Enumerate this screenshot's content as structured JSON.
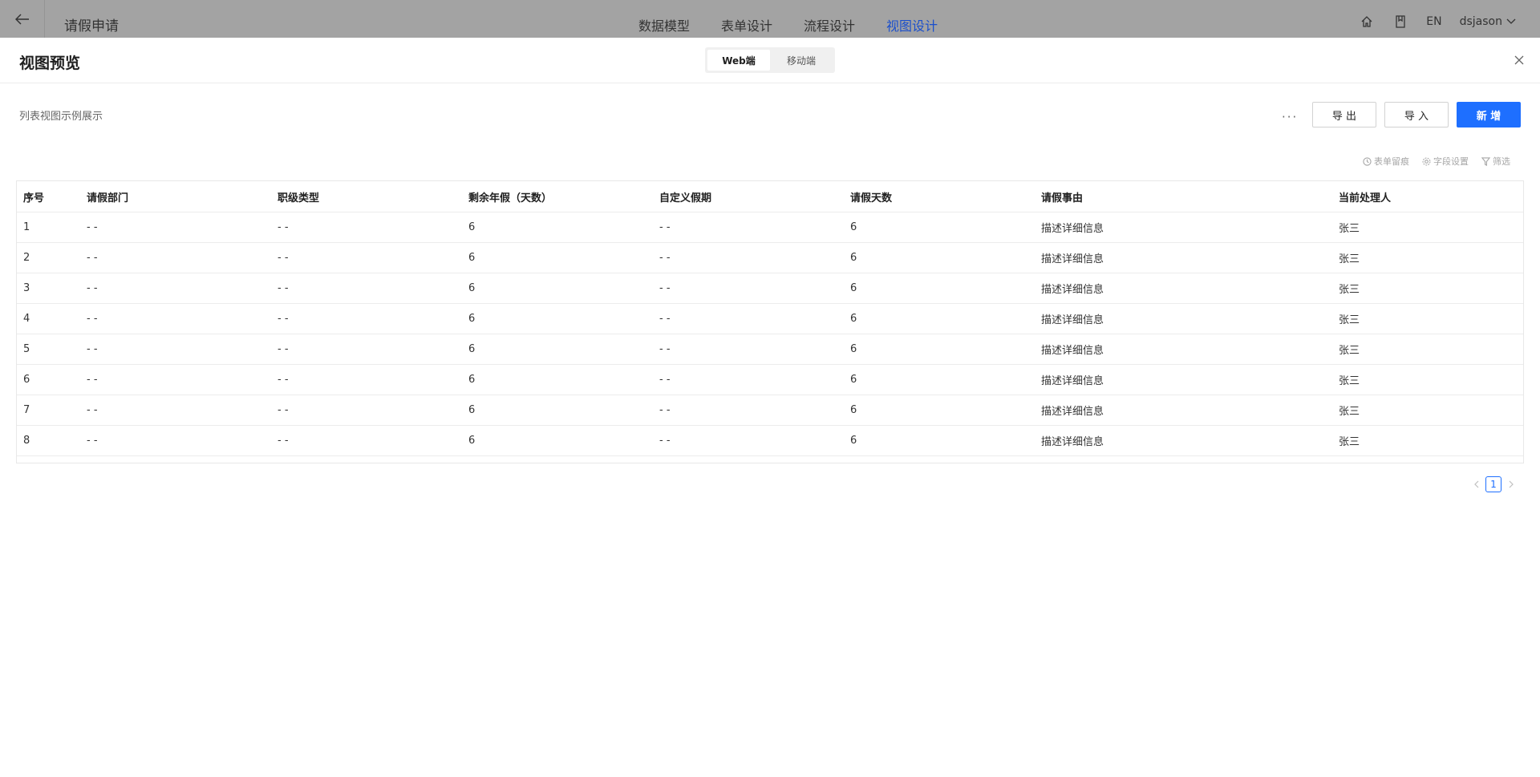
{
  "topbar": {
    "back_icon": "arrow-left-icon",
    "title": "请假申请",
    "nav": [
      {
        "label": "数据模型",
        "active": false
      },
      {
        "label": "表单设计",
        "active": false
      },
      {
        "label": "流程设计",
        "active": false
      },
      {
        "label": "视图设计",
        "active": true
      }
    ],
    "lang": "EN",
    "user": "dsjason",
    "active_color": "#1b4fcc"
  },
  "modal": {
    "title": "视图预览",
    "segments": [
      {
        "label": "Web端",
        "active": true
      },
      {
        "label": "移动端",
        "active": false
      }
    ],
    "subtitle": "列表视图示例展示",
    "more": "···",
    "buttons": {
      "export": "导 出",
      "import": "导 入",
      "add": "新 增"
    },
    "primary_color": "#1e6fff",
    "toolbar": {
      "history": "表单留痕",
      "fields": "字段设置",
      "filter": "筛选"
    }
  },
  "table": {
    "columns": [
      "序号",
      "请假部门",
      "职级类型",
      "剩余年假（天数）",
      "自定义假期",
      "请假天数",
      "请假事由",
      "当前处理人"
    ],
    "rows": [
      [
        "1",
        "- -",
        "- -",
        "6",
        "- -",
        "6",
        "描述详细信息",
        "张三"
      ],
      [
        "2",
        "- -",
        "- -",
        "6",
        "- -",
        "6",
        "描述详细信息",
        "张三"
      ],
      [
        "3",
        "- -",
        "- -",
        "6",
        "- -",
        "6",
        "描述详细信息",
        "张三"
      ],
      [
        "4",
        "- -",
        "- -",
        "6",
        "- -",
        "6",
        "描述详细信息",
        "张三"
      ],
      [
        "5",
        "- -",
        "- -",
        "6",
        "- -",
        "6",
        "描述详细信息",
        "张三"
      ],
      [
        "6",
        "- -",
        "- -",
        "6",
        "- -",
        "6",
        "描述详细信息",
        "张三"
      ],
      [
        "7",
        "- -",
        "- -",
        "6",
        "- -",
        "6",
        "描述详细信息",
        "张三"
      ],
      [
        "8",
        "- -",
        "- -",
        "6",
        "- -",
        "6",
        "描述详细信息",
        "张三"
      ]
    ]
  },
  "pagination": {
    "current": "1"
  }
}
